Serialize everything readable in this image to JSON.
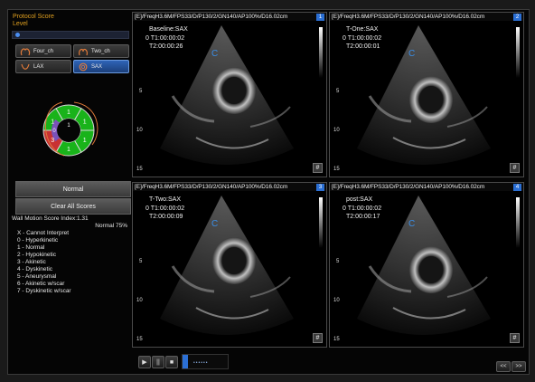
{
  "panel": {
    "title_line1": "Protocol Score",
    "title_line2": "Level",
    "views": [
      {
        "label": "Four_ch",
        "selected": false
      },
      {
        "label": "Two_ch",
        "selected": false
      },
      {
        "label": "LAX",
        "selected": false
      },
      {
        "label": "SAX",
        "selected": true
      }
    ],
    "segments": {
      "outer": [
        "1",
        "1",
        "1",
        "1",
        "3",
        "1"
      ],
      "inner": [
        "1"
      ],
      "left_label": "0",
      "colors": {
        "normal": "#19b31a",
        "hypokinetic": "#7a52b8",
        "akinetic": "#c83232",
        "unscored": "#e0e0e0"
      }
    },
    "score_button": "Normal",
    "clear_button": "Clear All Scores",
    "wms_index_label": "Wall Motion Score Index:1.31",
    "wms_normal": "Normal 75%",
    "legend": [
      "X - Cannot Interpret",
      "0 - Hyperkinetic",
      "1 - Normal",
      "2 - Hypokinetic",
      "3 - Akinetic",
      "4 - Dyskinetic",
      "5 - Aneurysmal",
      "6 - Akinetic w/scar",
      "7 - Dyskinetic w/scar"
    ]
  },
  "viewports": [
    {
      "num": "1",
      "params": "/FreqH3.6M/FPS33/D/P130/2/GN140/AP100%/D16.02cm",
      "stage": "Baseline:SAX",
      "t1": "T1:00:00:02",
      "t2": "T2:00:00:26",
      "zero": "0",
      "hash": "#"
    },
    {
      "num": "2",
      "params": "/FreqH3.6M/FPS33/D/P130/2/GN140/AP100%/D16.02cm",
      "stage": "T-One:SAX",
      "t1": "T1:00:00:02",
      "t2": "T2:00:00:01",
      "zero": "0",
      "hash": "#"
    },
    {
      "num": "3",
      "params": "/FreqH3.6M/FPS33/D/P130/2/GN140/AP100%/D16.02cm",
      "stage": "T-Two:SAX",
      "t1": "T1:00:00:02",
      "t2": "T2:00:00:09",
      "zero": "0",
      "hash": "#"
    },
    {
      "num": "4",
      "params": "/FreqH3.6M/FPS33/D/P130/2/GN140/AP100%/D16.02cm",
      "stage": "post:SAX",
      "t1": "T1:00:00:02",
      "t2": "T2:00:00:17",
      "zero": "0",
      "hash": "#"
    }
  ],
  "depth_ticks": [
    "5",
    "10",
    "15"
  ],
  "image_marker": "C",
  "bracket": "[E]",
  "toolbar": {
    "play": "▶",
    "pause": "||",
    "stop": "■",
    "prev": "<<",
    "next": ">>"
  },
  "icons": [
    "play-icon",
    "pause-icon",
    "stop-icon",
    "cine-slider",
    "prev-icon",
    "next-icon",
    "heart-view-icon"
  ]
}
